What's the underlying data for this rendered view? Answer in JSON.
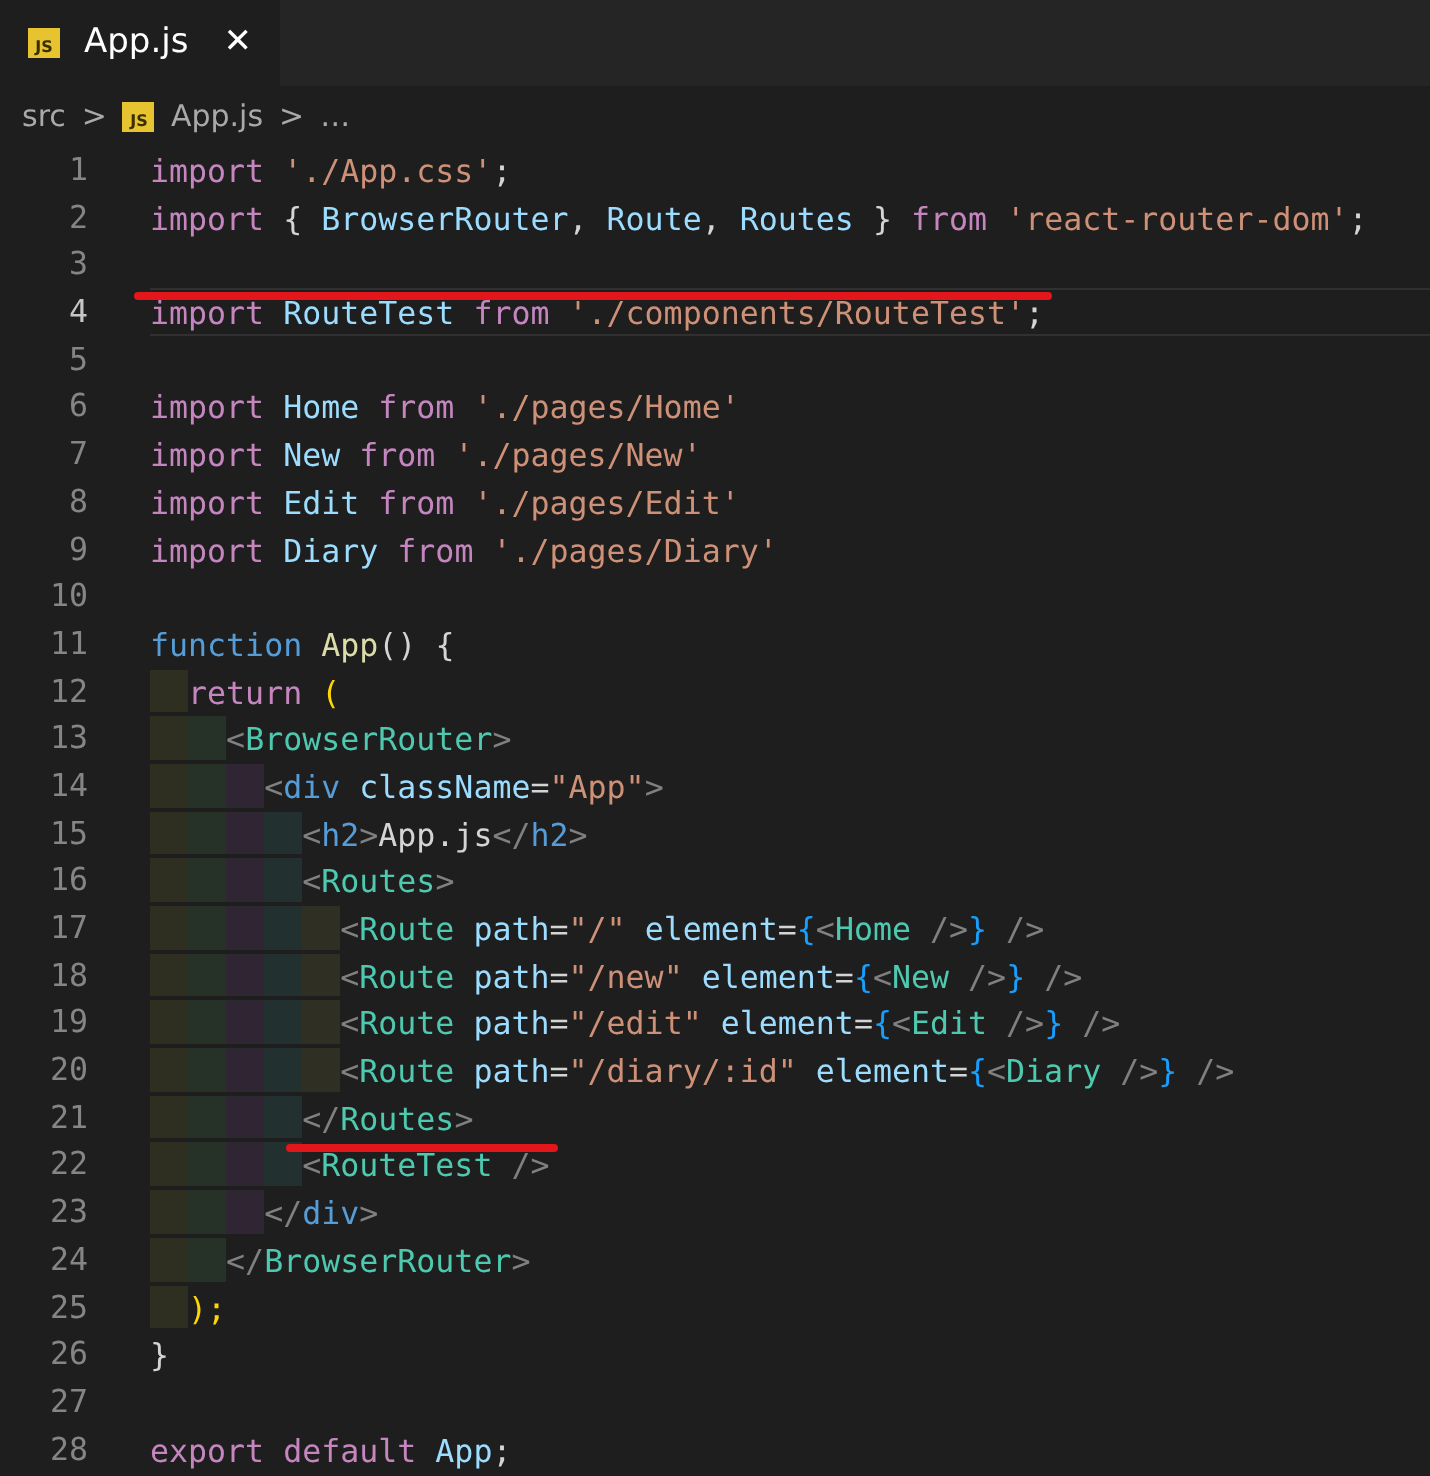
{
  "tab": {
    "icon_text": "JS",
    "title": "App.js",
    "close": "✕",
    "selected": true
  },
  "breadcrumb": [
    {
      "kind": "folder",
      "text": "src"
    },
    {
      "kind": "sep",
      "text": ">"
    },
    {
      "kind": "file",
      "icon_text": "JS",
      "text": "App.js"
    },
    {
      "kind": "sep",
      "text": ">"
    },
    {
      "kind": "more",
      "text": "…"
    }
  ],
  "lines": [
    {
      "number": "1",
      "current": false,
      "struck": false,
      "tokens": [
        {
          "text": "import ",
          "kind": "kw"
        },
        {
          "text": "'./App.css'",
          "kind": "str"
        },
        {
          "text": ";",
          "kind": "punc"
        }
      ]
    },
    {
      "number": "2",
      "current": false,
      "struck": false,
      "tokens": [
        {
          "text": "import ",
          "kind": "kw"
        },
        {
          "text": "{ ",
          "kind": "punc"
        },
        {
          "text": "BrowserRouter",
          "kind": "var"
        },
        {
          "text": ", ",
          "kind": "punc"
        },
        {
          "text": "Route",
          "kind": "var"
        },
        {
          "text": ", ",
          "kind": "punc"
        },
        {
          "text": "Routes",
          "kind": "var"
        },
        {
          "text": " } ",
          "kind": "punc"
        },
        {
          "text": "from ",
          "kind": "kw"
        },
        {
          "text": "'react-router-dom'",
          "kind": "str"
        },
        {
          "text": ";",
          "kind": "punc"
        }
      ]
    },
    {
      "number": "3",
      "current": false,
      "struck": false
    },
    {
      "number": "4",
      "current": true,
      "struck": true,
      "tokens": [
        {
          "text": "import ",
          "kind": "kw"
        },
        {
          "text": "RouteTest ",
          "kind": "var"
        },
        {
          "text": "from ",
          "kind": "kw"
        },
        {
          "text": "'./components/RouteTest'",
          "kind": "str"
        },
        {
          "text": ";",
          "kind": "punc"
        }
      ]
    },
    {
      "number": "5",
      "current": false,
      "struck": false
    },
    {
      "number": "6",
      "current": false,
      "struck": false,
      "tokens": [
        {
          "text": "import ",
          "kind": "kw"
        },
        {
          "text": "Home ",
          "kind": "var"
        },
        {
          "text": "from ",
          "kind": "kw"
        },
        {
          "text": "'./pages/Home'",
          "kind": "str"
        }
      ]
    },
    {
      "number": "7",
      "current": false,
      "struck": false,
      "tokens": [
        {
          "text": "import ",
          "kind": "kw"
        },
        {
          "text": "New ",
          "kind": "var"
        },
        {
          "text": "from ",
          "kind": "kw"
        },
        {
          "text": "'./pages/New'",
          "kind": "str"
        }
      ]
    },
    {
      "number": "8",
      "current": false,
      "struck": false,
      "tokens": [
        {
          "text": "import ",
          "kind": "kw"
        },
        {
          "text": "Edit ",
          "kind": "var"
        },
        {
          "text": "from ",
          "kind": "kw"
        },
        {
          "text": "'./pages/Edit'",
          "kind": "str"
        }
      ]
    },
    {
      "number": "9",
      "current": false,
      "struck": false,
      "tokens": [
        {
          "text": "import ",
          "kind": "kw"
        },
        {
          "text": "Diary ",
          "kind": "var"
        },
        {
          "text": "from ",
          "kind": "kw"
        },
        {
          "text": "'./pages/Diary'",
          "kind": "str"
        }
      ]
    },
    {
      "number": "10",
      "current": false,
      "struck": false
    },
    {
      "number": "11",
      "current": false,
      "struck": false,
      "tokens": [
        {
          "text": "function ",
          "kind": "decl"
        },
        {
          "text": "App",
          "kind": "fn"
        },
        {
          "text": "() {",
          "kind": "punc"
        }
      ]
    },
    {
      "number": "12",
      "current": false,
      "struck": false,
      "tokens": [
        {
          "text": "  return ",
          "kind": "kw"
        },
        {
          "text": "(",
          "kind": "gold"
        }
      ]
    },
    {
      "number": "13",
      "current": false,
      "struck": false,
      "tokens": [
        {
          "text": "    <",
          "kind": "angle"
        },
        {
          "text": "BrowserRouter",
          "kind": "comp"
        },
        {
          "text": ">",
          "kind": "angle"
        }
      ]
    },
    {
      "number": "14",
      "current": false,
      "struck": false,
      "tokens": [
        {
          "text": "      <",
          "kind": "angle"
        },
        {
          "text": "div ",
          "kind": "decl"
        },
        {
          "text": "className",
          "kind": "var"
        },
        {
          "text": "=",
          "kind": "punc"
        },
        {
          "text": "\"App\"",
          "kind": "str"
        },
        {
          "text": ">",
          "kind": "angle"
        }
      ]
    },
    {
      "number": "15",
      "current": false,
      "struck": false,
      "tokens": [
        {
          "text": "        <",
          "kind": "angle"
        },
        {
          "text": "h2",
          "kind": "decl"
        },
        {
          "text": ">",
          "kind": "angle"
        },
        {
          "text": "App.js",
          "kind": "punc"
        },
        {
          "text": "</",
          "kind": "angle"
        },
        {
          "text": "h2",
          "kind": "decl"
        },
        {
          "text": ">",
          "kind": "angle"
        }
      ]
    },
    {
      "number": "16",
      "current": false,
      "struck": false,
      "tokens": [
        {
          "text": "        <",
          "kind": "angle"
        },
        {
          "text": "Routes",
          "kind": "comp"
        },
        {
          "text": ">",
          "kind": "angle"
        }
      ]
    },
    {
      "number": "17",
      "current": false,
      "struck": false,
      "tokens": [
        {
          "text": "          <",
          "kind": "angle"
        },
        {
          "text": "Route ",
          "kind": "comp"
        },
        {
          "text": "path",
          "kind": "var"
        },
        {
          "text": "=",
          "kind": "punc"
        },
        {
          "text": "\"/\" ",
          "kind": "str"
        },
        {
          "text": "element",
          "kind": "var"
        },
        {
          "text": "=",
          "kind": "punc"
        },
        {
          "text": "{",
          "kind": "blue"
        },
        {
          "text": "<",
          "kind": "angle"
        },
        {
          "text": "Home",
          "kind": "comp"
        },
        {
          "text": " />",
          "kind": "angle"
        },
        {
          "text": "}",
          "kind": "blue"
        },
        {
          "text": " />",
          "kind": "angle"
        }
      ]
    },
    {
      "number": "18",
      "current": false,
      "struck": false,
      "tokens": [
        {
          "text": "          <",
          "kind": "angle"
        },
        {
          "text": "Route ",
          "kind": "comp"
        },
        {
          "text": "path",
          "kind": "var"
        },
        {
          "text": "=",
          "kind": "punc"
        },
        {
          "text": "\"/new\" ",
          "kind": "str"
        },
        {
          "text": "element",
          "kind": "var"
        },
        {
          "text": "=",
          "kind": "punc"
        },
        {
          "text": "{",
          "kind": "blue"
        },
        {
          "text": "<",
          "kind": "angle"
        },
        {
          "text": "New",
          "kind": "comp"
        },
        {
          "text": " />",
          "kind": "angle"
        },
        {
          "text": "}",
          "kind": "blue"
        },
        {
          "text": " />",
          "kind": "angle"
        }
      ]
    },
    {
      "number": "19",
      "current": false,
      "struck": false,
      "tokens": [
        {
          "text": "          <",
          "kind": "angle"
        },
        {
          "text": "Route ",
          "kind": "comp"
        },
        {
          "text": "path",
          "kind": "var"
        },
        {
          "text": "=",
          "kind": "punc"
        },
        {
          "text": "\"/edit\" ",
          "kind": "str"
        },
        {
          "text": "element",
          "kind": "var"
        },
        {
          "text": "=",
          "kind": "punc"
        },
        {
          "text": "{",
          "kind": "blue"
        },
        {
          "text": "<",
          "kind": "angle"
        },
        {
          "text": "Edit",
          "kind": "comp"
        },
        {
          "text": " />",
          "kind": "angle"
        },
        {
          "text": "}",
          "kind": "blue"
        },
        {
          "text": " />",
          "kind": "angle"
        }
      ]
    },
    {
      "number": "20",
      "current": false,
      "struck": false,
      "tokens": [
        {
          "text": "          <",
          "kind": "angle"
        },
        {
          "text": "Route ",
          "kind": "comp"
        },
        {
          "text": "path",
          "kind": "var"
        },
        {
          "text": "=",
          "kind": "punc"
        },
        {
          "text": "\"/diary/:id\" ",
          "kind": "str"
        },
        {
          "text": "element",
          "kind": "var"
        },
        {
          "text": "=",
          "kind": "punc"
        },
        {
          "text": "{",
          "kind": "blue"
        },
        {
          "text": "<",
          "kind": "angle"
        },
        {
          "text": "Diary",
          "kind": "comp"
        },
        {
          "text": " />",
          "kind": "angle"
        },
        {
          "text": "}",
          "kind": "blue"
        },
        {
          "text": " />",
          "kind": "angle"
        }
      ]
    },
    {
      "number": "21",
      "current": false,
      "struck": false,
      "tokens": [
        {
          "text": "        </",
          "kind": "angle"
        },
        {
          "text": "Routes",
          "kind": "comp"
        },
        {
          "text": ">",
          "kind": "angle"
        }
      ]
    },
    {
      "number": "22",
      "current": false,
      "struck": true,
      "tokens": [
        {
          "text": "        <",
          "kind": "angle"
        },
        {
          "text": "RouteTest",
          "kind": "comp"
        },
        {
          "text": " />",
          "kind": "angle"
        }
      ]
    },
    {
      "number": "23",
      "current": false,
      "struck": false,
      "tokens": [
        {
          "text": "      </",
          "kind": "angle"
        },
        {
          "text": "div",
          "kind": "decl"
        },
        {
          "text": ">",
          "kind": "angle"
        }
      ]
    },
    {
      "number": "24",
      "current": false,
      "struck": false,
      "tokens": [
        {
          "text": "    </",
          "kind": "angle"
        },
        {
          "text": "BrowserRouter",
          "kind": "comp"
        },
        {
          "text": ">",
          "kind": "angle"
        }
      ]
    },
    {
      "number": "25",
      "current": false,
      "struck": false,
      "tokens": [
        {
          "text": "  );",
          "kind": "gold"
        }
      ]
    },
    {
      "number": "26",
      "current": false,
      "struck": false,
      "tokens": [
        {
          "text": "}",
          "kind": "punc"
        }
      ]
    },
    {
      "number": "27",
      "current": false,
      "struck": false
    },
    {
      "number": "28",
      "current": false,
      "struck": false,
      "tokens": [
        {
          "text": "export ",
          "kind": "kw"
        },
        {
          "text": "default ",
          "kind": "kw"
        },
        {
          "text": "App",
          "kind": "var"
        },
        {
          "text": ";",
          "kind": "punc"
        }
      ]
    }
  ]
}
